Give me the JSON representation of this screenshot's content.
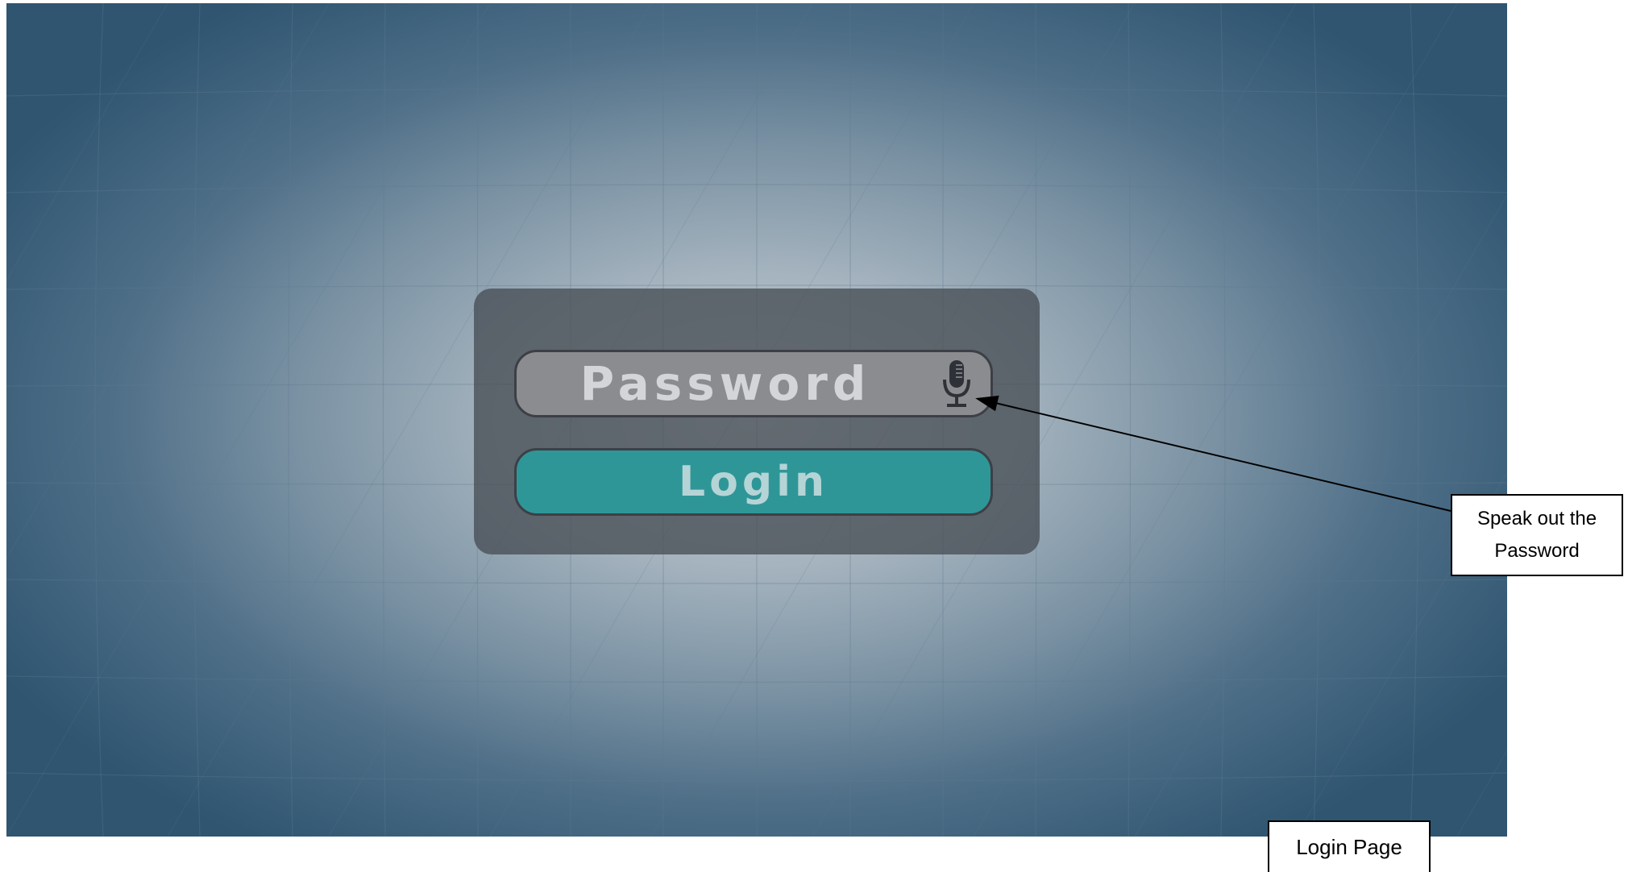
{
  "login_form": {
    "password_placeholder": "Password",
    "mic_icon": "microphone-icon",
    "login_label": "Login"
  },
  "annotations": {
    "callout_line1": "Speak out the",
    "callout_line2": "Password",
    "page_label": "Login Page"
  },
  "colors": {
    "card": "#484e54",
    "field": "#8a8c8f",
    "button": "#2f9698",
    "background_center": "#c4ced6",
    "background_edge": "#2f5570"
  }
}
